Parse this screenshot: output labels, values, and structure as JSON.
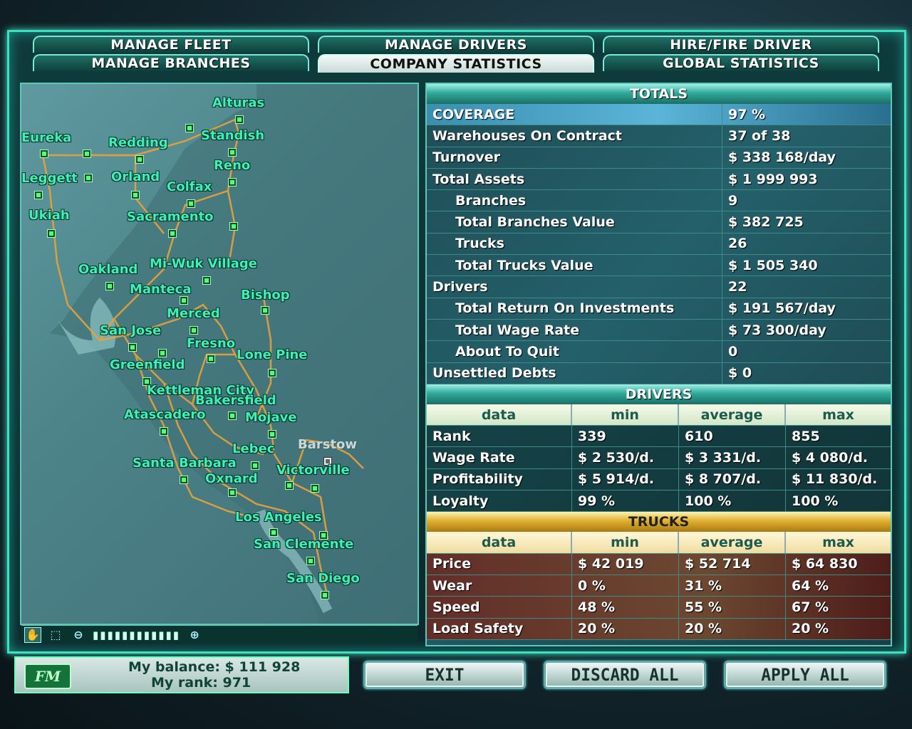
{
  "tabs": {
    "manage_fleet": "MANAGE FLEET",
    "manage_drivers": "MANAGE DRIVERS",
    "hire_fire_driver": "HIRE/FIRE DRIVER",
    "manage_branches": "MANAGE BRANCHES",
    "company_statistics": "COMPANY STATISTICS",
    "global_statistics": "GLOBAL STATISTICS"
  },
  "map": {
    "cities": [
      "Alturas",
      "Eureka",
      "Redding",
      "Standish",
      "Reno",
      "Leggett",
      "Orland",
      "Colfax",
      "Ukiah",
      "Sacramento",
      "Oakland",
      "Mi-Wuk Village",
      "Manteca",
      "Bishop",
      "Merced",
      "San Jose",
      "Fresno",
      "Lone Pine",
      "Greenfield",
      "Kettleman City",
      "Bakersfield",
      "Atascadero",
      "Mojave",
      "Barstow",
      "Lebec",
      "Santa Barbara",
      "Victorville",
      "Oxnard",
      "Los Angeles",
      "San Clemente",
      "San Diego"
    ]
  },
  "totals": {
    "header": "TOTALS",
    "rows": [
      {
        "label": "COVERAGE",
        "value": "97 %"
      },
      {
        "label": "Warehouses On Contract",
        "value": "37 of 38"
      },
      {
        "label": "Turnover",
        "value": "$ 338 168/day"
      },
      {
        "label": "Total Assets",
        "value": "$ 1 999 993"
      },
      {
        "label": "Branches",
        "value": "9"
      },
      {
        "label": "Total Branches Value",
        "value": "$ 382 725"
      },
      {
        "label": "Trucks",
        "value": "26"
      },
      {
        "label": "Total Trucks Value",
        "value": "$ 1 505 340"
      },
      {
        "label": "Drivers",
        "value": "22"
      },
      {
        "label": "Total Return On Investments",
        "value": "$ 191 567/day"
      },
      {
        "label": "Total Wage Rate",
        "value": "$ 73 300/day"
      },
      {
        "label": "About To Quit",
        "value": "0"
      },
      {
        "label": "Unsettled Debts",
        "value": "$ 0"
      }
    ]
  },
  "drivers": {
    "header": "DRIVERS",
    "columns": [
      "data",
      "min",
      "average",
      "max"
    ],
    "rows": [
      [
        "Rank",
        "339",
        "610",
        "855"
      ],
      [
        "Wage Rate",
        "$ 2 530/d.",
        "$ 3 331/d.",
        "$ 4 080/d."
      ],
      [
        "Profitability",
        "$ 5 914/d.",
        "$ 8 707/d.",
        "$ 11 830/d."
      ],
      [
        "Loyalty",
        "99 %",
        "100 %",
        "100 %"
      ]
    ]
  },
  "trucks": {
    "header": "TRUCKS",
    "columns": [
      "data",
      "min",
      "average",
      "max"
    ],
    "rows": [
      [
        "Price",
        "$ 42 019",
        "$ 52 714",
        "$ 64 830"
      ],
      [
        "Wear",
        "0 %",
        "31 %",
        "64 %"
      ],
      [
        "Speed",
        "48 %",
        "55 %",
        "67 %"
      ],
      [
        "Load Safety",
        "20 %",
        "20 %",
        "20 %"
      ]
    ]
  },
  "footer": {
    "logo": "FM",
    "balance": "My balance: $ 111 928",
    "rank": "My rank: 971",
    "exit": "EXIT",
    "discard_all": "DISCARD ALL",
    "apply_all": "APPLY ALL"
  }
}
